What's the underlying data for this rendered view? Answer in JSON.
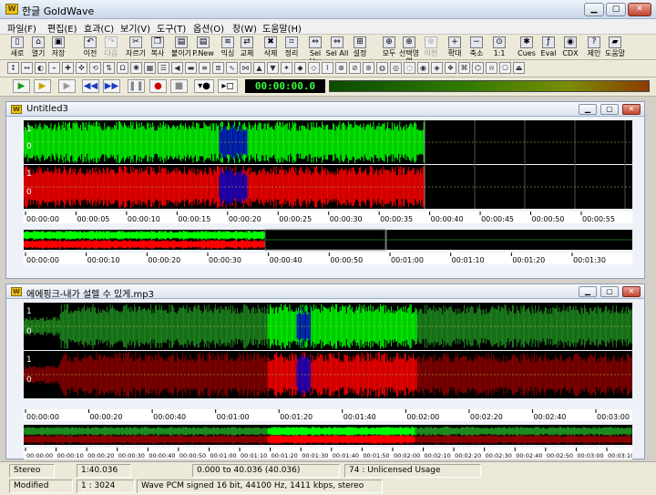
{
  "window": {
    "title": "한글 GoldWave",
    "app_icon": "goldwave-icon"
  },
  "menu": [
    "파일(F)",
    "편집(E)",
    "효과(C)",
    "보기(V)",
    "도구(T)",
    "옵션(O)",
    "창(W)",
    "도움말(H)"
  ],
  "toolbar_main": [
    {
      "label": "새로",
      "icon": "new-icon",
      "enabled": true
    },
    {
      "label": "열기",
      "icon": "open-icon",
      "enabled": true
    },
    {
      "label": "저장",
      "icon": "save-icon",
      "enabled": true
    },
    {
      "label": "이전",
      "icon": "undo-icon",
      "enabled": true
    },
    {
      "label": "다음",
      "icon": "redo-icon",
      "enabled": false
    },
    {
      "label": "자르기",
      "icon": "cut-icon",
      "enabled": true
    },
    {
      "label": "복사",
      "icon": "copy-icon",
      "enabled": true
    },
    {
      "label": "붙이기",
      "icon": "paste-icon",
      "enabled": true
    },
    {
      "label": "P.New",
      "icon": "paste-new-icon",
      "enabled": true
    },
    {
      "label": "믹싱",
      "icon": "mix-icon",
      "enabled": true
    },
    {
      "label": "교체",
      "icon": "replace-icon",
      "enabled": true
    },
    {
      "label": "삭제",
      "icon": "delete-icon",
      "enabled": true
    },
    {
      "label": "정리",
      "icon": "trim-icon",
      "enabled": true
    },
    {
      "label": "Sel Vw",
      "icon": "select-view-icon",
      "enabled": true
    },
    {
      "label": "Sel All",
      "icon": "select-all-icon",
      "enabled": true
    },
    {
      "label": "설정",
      "icon": "set-icon",
      "enabled": true
    },
    {
      "label": "모두",
      "icon": "zoom-all-icon",
      "enabled": true
    },
    {
      "label": "선택영역",
      "icon": "zoom-selection-icon",
      "enabled": true
    },
    {
      "label": "이전",
      "icon": "zoom-previous-icon",
      "enabled": false
    },
    {
      "label": "확대",
      "icon": "zoom-in-icon",
      "enabled": true
    },
    {
      "label": "축소",
      "icon": "zoom-out-icon",
      "enabled": true
    },
    {
      "label": "1:1",
      "icon": "zoom-1to1-icon",
      "enabled": true
    },
    {
      "label": "Cues",
      "icon": "cues-icon",
      "enabled": true
    },
    {
      "label": "Eval",
      "icon": "eval-icon",
      "enabled": true
    },
    {
      "label": "CDX",
      "icon": "cd-extract-icon",
      "enabled": true
    },
    {
      "label": "제인",
      "icon": "help-icon",
      "enabled": true
    },
    {
      "label": "도움말",
      "icon": "book-icon",
      "enabled": true
    }
  ],
  "playback": {
    "time": "00:00:00.0"
  },
  "doc1": {
    "title": "Untitled3",
    "ruler": [
      "00:00:00",
      "00:00:05",
      "00:00:10",
      "00:00:15",
      "00:00:20",
      "00:00:25",
      "00:00:30",
      "00:00:35",
      "00:00:40",
      "00:00:45",
      "00:00:50",
      "00:00:55"
    ],
    "overview_ruler": [
      "00:00:00",
      "00:00:10",
      "00:00:20",
      "00:00:30",
      "00:00:40",
      "00:00:50",
      "00:01:00",
      "00:01:10",
      "00:01:20",
      "00:01:30"
    ],
    "channel_marks": [
      "1",
      "0",
      "1",
      "0"
    ]
  },
  "doc2": {
    "title": "에에핑크-내가 설렐 수 있게.mp3",
    "ruler": [
      "00:00:00",
      "00:00:20",
      "00:00:40",
      "00:01:00",
      "00:01:20",
      "00:01:40",
      "00:02:00",
      "00:02:20",
      "00:02:40",
      "00:03:00"
    ],
    "overview_ruler": [
      "00:00:00",
      "00:00:10",
      "00:00:20",
      "00:00:30",
      "00:00:40",
      "00:00:50",
      "00:01:00",
      "00:01:10",
      "00:01:20",
      "00:01:30",
      "00:01:40",
      "00:01:50",
      "00:02:00",
      "00:02:10",
      "00:02:20",
      "00:02:30",
      "00:02:40",
      "00:02:50",
      "00:03:00",
      "00:03:10"
    ],
    "channel_marks": [
      "1",
      "0",
      "1",
      "0"
    ]
  },
  "status": {
    "row1": {
      "channels": "Stereo",
      "length": "1:40.036",
      "selection": "0.000 to 40.036 (40.036)",
      "note": "74 : Unlicensed Usage"
    },
    "row2": {
      "state": "Modified",
      "zoom": "1 : 3024",
      "format": "Wave PCM signed 16 bit, 44100 Hz, 1411 kbps, stereo"
    }
  },
  "colors": {
    "left_channel": "#00ff00",
    "right_channel": "#ff0000",
    "selected_overlap": "#0000c0",
    "dim_left": "#1e8a1e",
    "dim_right": "#8a0000"
  }
}
